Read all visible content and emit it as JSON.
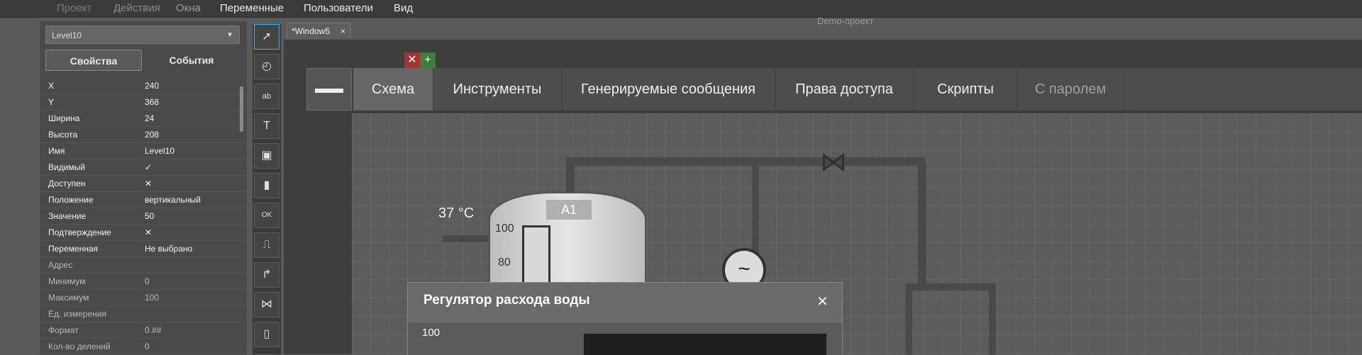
{
  "menu": {
    "items": [
      "Проект",
      "Действия",
      "Окна",
      "Переменные",
      "Пользователи",
      "Вид"
    ],
    "project_name": "Demo-проект"
  },
  "properties_panel": {
    "object_selector": "Level10",
    "tabs": {
      "properties": "Свойства",
      "events": "События"
    },
    "rows": [
      {
        "key": "X",
        "value": "240"
      },
      {
        "key": "Y",
        "value": "368"
      },
      {
        "key": "Ширина",
        "value": "24"
      },
      {
        "key": "Высота",
        "value": "208"
      },
      {
        "key": "Имя",
        "value": "Level10"
      },
      {
        "key": "Видимый",
        "value": "✓"
      },
      {
        "key": "Доступен",
        "value": "✕"
      },
      {
        "key": "Положение",
        "value": "вертикальный"
      },
      {
        "key": "Значение",
        "value": "50"
      },
      {
        "key": "Подтверждение",
        "value": "✕"
      },
      {
        "key": "Переменная",
        "value": "Не выбрано"
      },
      {
        "key": "Адрес",
        "value": ""
      },
      {
        "key": "Минимум",
        "value": "0"
      },
      {
        "key": "Максимум",
        "value": "100"
      },
      {
        "key": "Ед. измерения",
        "value": ""
      },
      {
        "key": "Формат",
        "value": "0.##"
      },
      {
        "key": "Кол-во делений",
        "value": "0"
      }
    ]
  },
  "toolbar": {
    "tools": [
      "cursor-icon",
      "shapes-icon",
      "textbox-icon",
      "text-icon",
      "image-icon",
      "gauge-icon",
      "ok-button-icon",
      "switch-icon",
      "pipe-icon",
      "valve-icon",
      "device-icon"
    ]
  },
  "editor": {
    "doc_tab": "*Window5",
    "doc_tab_close": "×",
    "remove_btn": "✕",
    "add_btn": "+",
    "tabs": [
      "Схема",
      "Инструменты",
      "Генерируемые сообщения",
      "Права доступа",
      "Скрипты",
      "С паролем"
    ],
    "active_tab": "Схема",
    "temperature": "37 °C",
    "tank_label": "A1",
    "gauge_labels": [
      "100",
      "80"
    ],
    "dialog": {
      "title": "Регулятор расхода воды",
      "close": "✕",
      "scale_max": "100"
    }
  },
  "colors": {
    "background": "#5a5a5a",
    "accent_selected": "#4ab0e8",
    "remove_red": "#a83232",
    "add_green": "#3e7d3e"
  }
}
